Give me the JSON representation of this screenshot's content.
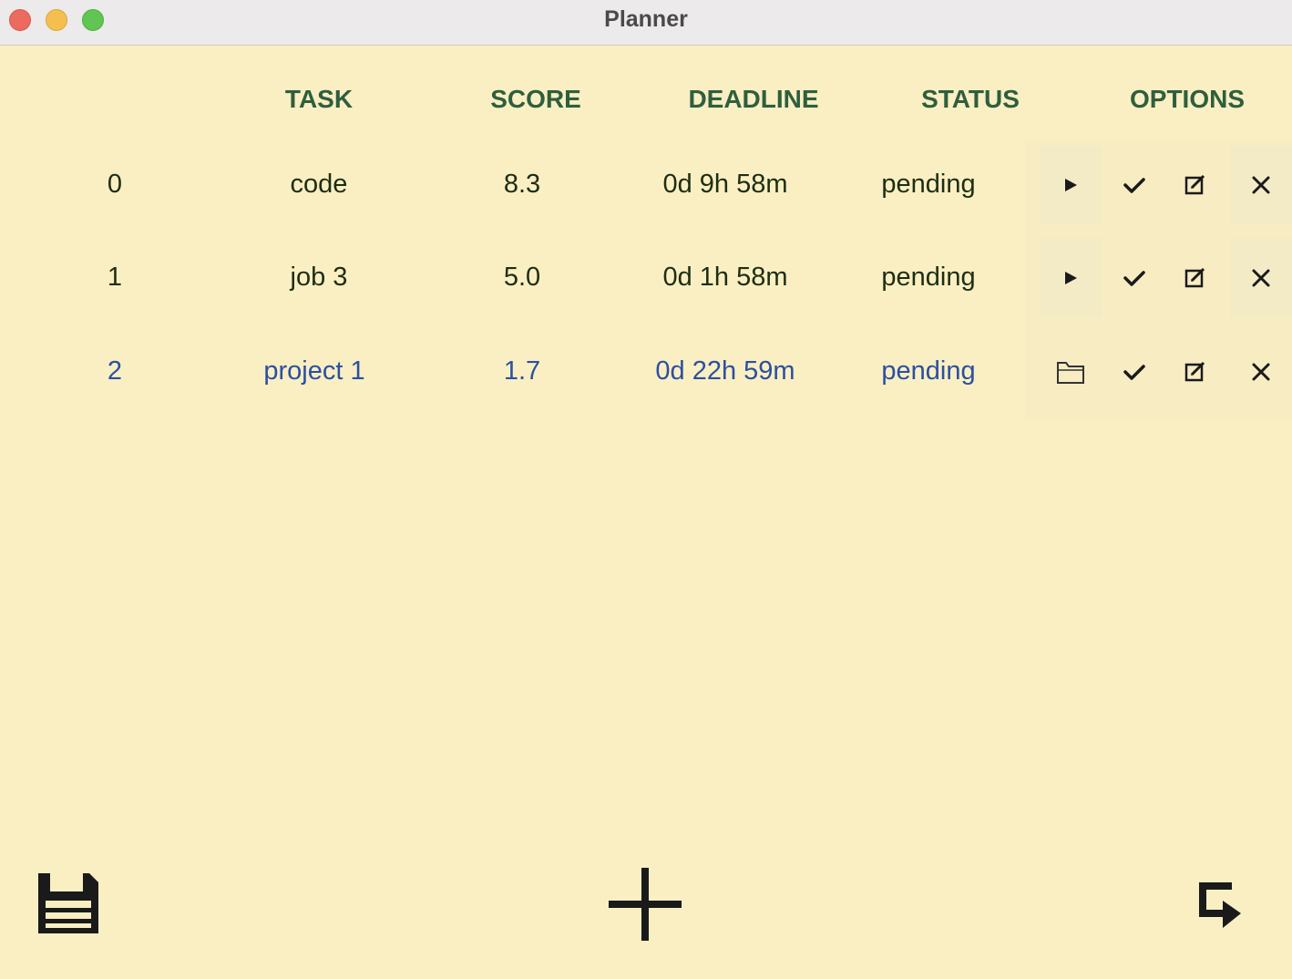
{
  "window": {
    "title": "Planner"
  },
  "table": {
    "headers": {
      "task": "TASK",
      "score": "SCORE",
      "deadline": "DEADLINE",
      "status": "STATUS",
      "options": "OPTIONS"
    },
    "rows": [
      {
        "index": "0",
        "task": "code",
        "score": "8.3",
        "deadline": "0d 9h 58m",
        "status": "pending",
        "primary_action_icon": "play-icon",
        "selected": false
      },
      {
        "index": "1",
        "task": "job 3",
        "score": "5.0",
        "deadline": "0d 1h 58m",
        "status": "pending",
        "primary_action_icon": "play-icon",
        "selected": false
      },
      {
        "index": "2",
        "task": "project 1",
        "score": "1.7",
        "deadline": "0d 22h 59m",
        "status": "pending",
        "primary_action_icon": "folder-icon",
        "selected": true
      }
    ],
    "option_icons": [
      "check-icon",
      "edit-icon",
      "close-icon"
    ]
  },
  "toolbar": {
    "save_icon": "save-icon",
    "add_icon": "plus-icon",
    "next_icon": "redirect-arrow-icon"
  },
  "colors": {
    "background": "#f9efc3",
    "header_text": "#2f5e3e",
    "row_text": "#1e2d12",
    "selected_row_text": "#2c4fa0"
  }
}
